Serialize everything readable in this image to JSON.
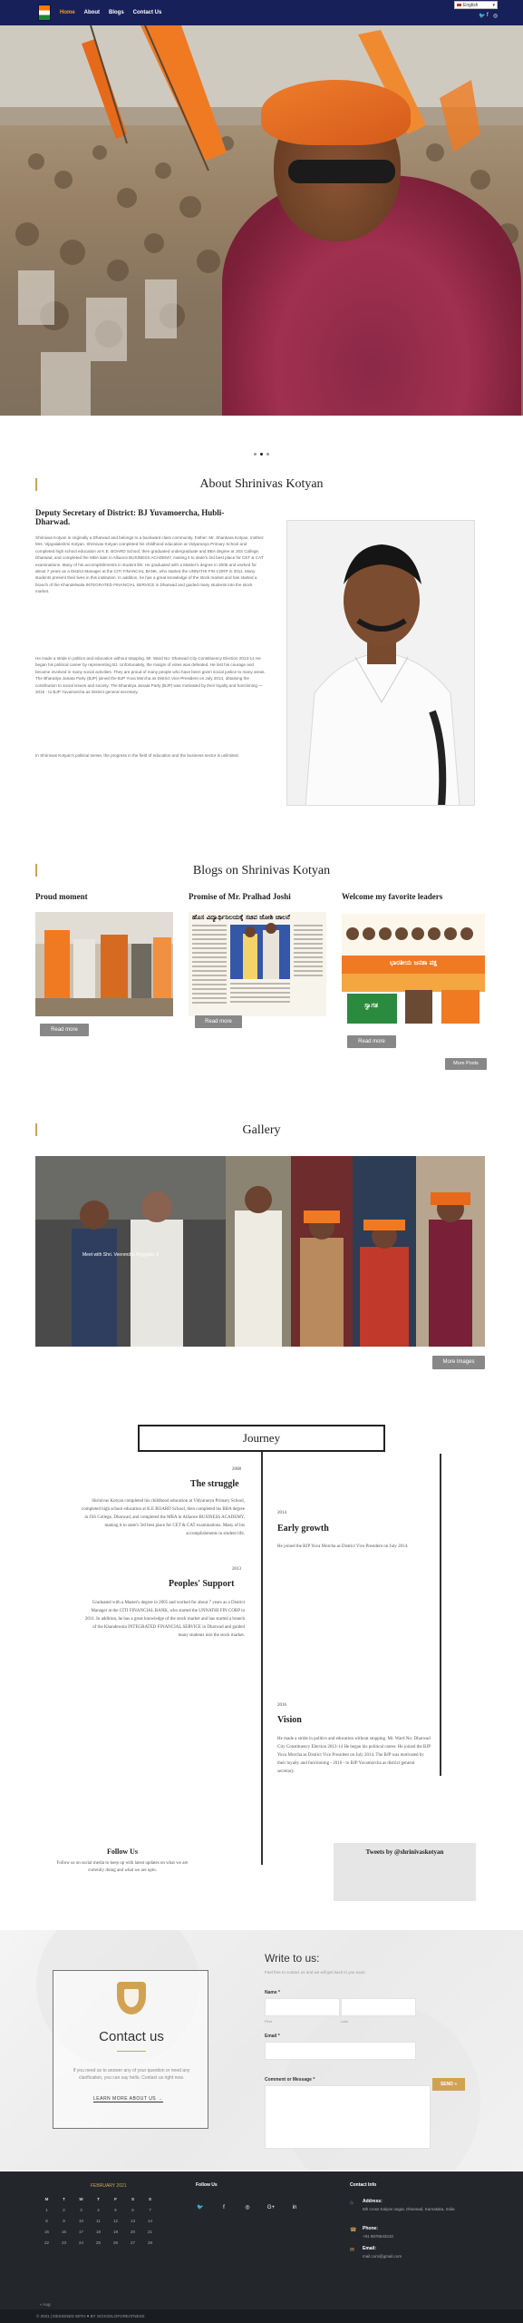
{
  "nav": {
    "items": [
      "Home",
      "About",
      "Blogs",
      "Contact Us"
    ],
    "language": "English",
    "social": [
      "twitter-icon",
      "facebook-icon",
      "instagram-icon"
    ]
  },
  "colors": {
    "nav_bg": "#182059",
    "accent": "#d2a253",
    "footer_bg": "#23272b"
  },
  "about": {
    "title": "About Shrinivas Kotyan",
    "subtitle": "Deputy Secretary of District: BJ Yuvamoercha, Hubli-Dharwad.",
    "paragraphs": [
      "Shrinivas Kotyan is originally a Dharwad and belongs to a backward class community. Father: Mr. Shankara Kotyan, mother: Mrs. Vijayalakshmi Kotyan. Shrinivas Kotyan completed his childhood education at Vidyaranya Primary School and completed high school education at K.E. BOARD School, then graduated undergraduate and BBA degree at JSS College, Dharwad, and completed the MBA later in Alliance BUSINESS ACADEMY, making it to state's 3rd best place for CET & CAT examinations. Many of his accomplishments in student life: He graduated with a Master's degree in 2005 and worked for about 7 years as a District Manager at the CITI FINANCIAL BANK, who started the UNNATHI FIN CORP in 2011. Many students present their lives in this institution. In addition, he has a great knowledge of the stock market and has started a branch of the Khandelwala INTEGRATED FINANCIAL SERVICE in Dharwad and guided many students into the stock market.",
      "He made a stride in politics and education without stopping. Mr. Ward No: Dharwad City Constituency Election 2013-14 He began his political career by representing BJ. Unfortunately, the margin of votes was defeated. He lost his courage and became involved in many social activities. They are proud of many people who have been given social justice to many areas. The Bharatiya Janata Party (BJP) joined the BJP Yuva Morcha as District Vice-President on July 2014, obtaining the contribution to social issues and society. The Bharatiya Janata Party (BJP) was motivated by their loyalty and functioning — 2016 - to BJP Yuvamorcha as District general secretary.",
      "In Shrinivas Kotyan's political sense, the progress in the field of education and the business sector is unlimited."
    ]
  },
  "blogs": {
    "title": "Blogs on Shrinivas Kotyan",
    "posts": [
      {
        "title": "Proud moment",
        "button": "Read more"
      },
      {
        "title": "Promise of Mr. Pralhad Joshi",
        "button": "Read more",
        "headline": "ಹೊಸ ವಿದ್ಯಾರ್ಥಿನಿಲಯಕ್ಕೆ ಸಚಿವ ಜೋಶಿ ಚಾಲನೆ"
      },
      {
        "title": "Welcome my favorite leaders",
        "button": "Read more",
        "banner": "ಭಾರತೀಯ ಜನತಾ ಪಕ್ಷ",
        "banner2": "ಸ್ವಾಗತ"
      }
    ],
    "more_button": "More Posts"
  },
  "gallery": {
    "title": "Gallery",
    "caption": "Meet with Shri. Veerendra Heggade Ji",
    "button": "More Images"
  },
  "journey": {
    "title": "Journey",
    "items": [
      {
        "year": "2008",
        "title": "The struggle",
        "text": "Shrinivas Kotyan completed his childhood education at Vidyaranya Primary School, completed high school education at K.E BOARD School, then completed his BBA degree in JSS College, Dharwad, and completed the MBA in Alliance BUSINESS ACADEMY, making it to state's 3rd best place for CET & CAT examinations. Many of his accomplishments in student life."
      },
      {
        "year": "2014",
        "title": "Early growth",
        "text": "He joined the BJP Yuva Morcha as District Vice President on July 2014."
      },
      {
        "year": "2013",
        "title": "Peoples' Support",
        "text": "Graduated with a Master's degree in 2005 and worked for about 7 years as a District Manager at the CITI FINANCIAL BANK, who started the UNNATHI FIN CORP in 2011. In addition, he has a great knowledge of the stock market and has started a branch of the Khandewala INTEGRATED FINANCIAL SERVICE in Dharwad and guided many students into the stock market."
      },
      {
        "year": "2016",
        "title": "Vision",
        "text": "He made a stride in politics and education without stopping. Mr. Ward No: Dharwad City Constituency Election 2013-14 He began his political career. He joined the BJP Yuva Morcha as District Vice President on July 2014. The BJP was motivated by their loyalty and functioning - 2016 - to BJP Yuvamorcha as district general secretary."
      }
    ]
  },
  "follow": {
    "title": "Follow Us",
    "text": "Follow us on social media to keep up with latest updates on what we are currently doing and what we are upto."
  },
  "tweets": {
    "title": "Tweets by @shrinivaskotyan"
  },
  "contact": {
    "card_title": "Contact us",
    "card_text": "If you need us to answer any of your question or need any clarification, you can say hello. Contact us right now.",
    "learn_more": "LEARN MORE ABOUT US →",
    "form_title": "Write to us:",
    "form_sub": "Feel free to contact us and we will get back to you soon",
    "name_label": "Name *",
    "first_label": "First",
    "last_label": "Last",
    "email_label": "Email *",
    "message_label": "Comment or Message *",
    "send": "SEND »"
  },
  "footer": {
    "calendar": {
      "month": "FEBRUARY 2021",
      "days": [
        "M",
        "T",
        "W",
        "T",
        "F",
        "S",
        "S"
      ],
      "weeks": [
        [
          "1",
          "2",
          "3",
          "4",
          "5",
          "6",
          "7"
        ],
        [
          "8",
          "9",
          "10",
          "11",
          "12",
          "13",
          "14"
        ],
        [
          "15",
          "16",
          "17",
          "18",
          "19",
          "20",
          "21"
        ],
        [
          "22",
          "23",
          "24",
          "25",
          "26",
          "27",
          "28"
        ]
      ],
      "prev": "« Aug"
    },
    "follow_title": "Follow Us",
    "social": [
      "twitter-icon",
      "facebook-icon",
      "instagram-icon",
      "googleplus-icon",
      "linkedin-icon"
    ],
    "contact_title": "Contact Info",
    "address_label": "Address:",
    "address": "6th cross Kalyan nagar, Dharwad, Karnataka, India",
    "phone_label": "Phone:",
    "phone": "+91 9876543210",
    "email_label": "Email:",
    "email": "mail.com@gmail.com"
  },
  "copyright": "© 2021 | DESIGNED WITH ♥ BY SCHOOLOFGREATNESS"
}
